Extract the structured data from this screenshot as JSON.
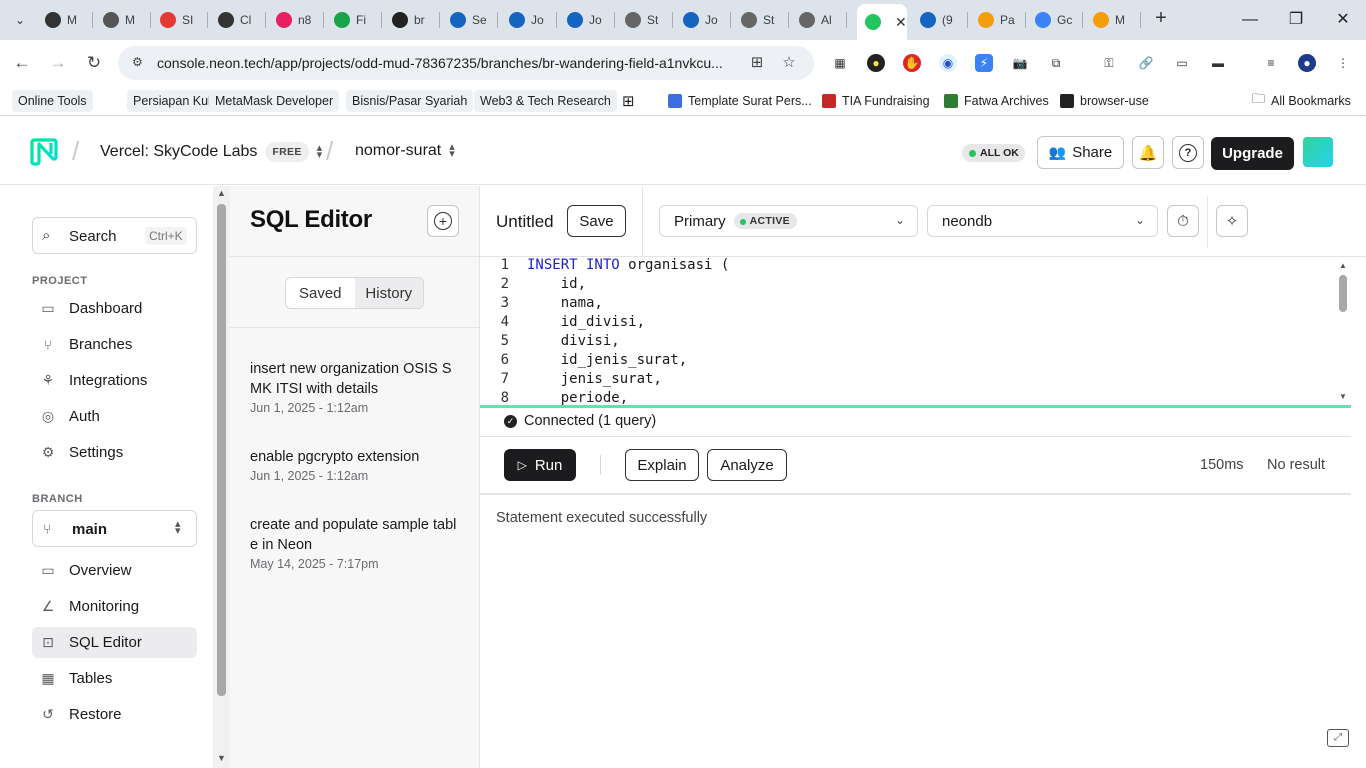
{
  "browser": {
    "tabs": [
      {
        "label": "M",
        "color": "#333"
      },
      {
        "label": "M",
        "color": "#555"
      },
      {
        "label": "SI",
        "color": "#e53935"
      },
      {
        "label": "Cl",
        "color": "#333"
      },
      {
        "label": "n8",
        "color": "#e91e63"
      },
      {
        "label": "Fi",
        "color": "#16a34a"
      },
      {
        "label": "br",
        "color": "#222"
      },
      {
        "label": "Se",
        "color": "#1565c0"
      },
      {
        "label": "Jo",
        "color": "#1565c0"
      },
      {
        "label": "Jo",
        "color": "#1565c0"
      },
      {
        "label": "St",
        "color": "#666"
      },
      {
        "label": "Jo",
        "color": "#1565c0"
      },
      {
        "label": "St",
        "color": "#666"
      },
      {
        "label": "Al",
        "color": "#666"
      },
      {
        "label": "",
        "color": "#22c55e",
        "active": true
      },
      {
        "label": "(9",
        "color": "#1565c0"
      },
      {
        "label": "Pa",
        "color": "#f59e0b"
      },
      {
        "label": "Gc",
        "color": "#3b82f6"
      },
      {
        "label": "M",
        "color": "#f59e0b"
      }
    ],
    "url": "console.neon.tech/app/projects/odd-mud-78367235/branches/br-wandering-field-a1nvkcu...",
    "bookmarks": [
      {
        "label": "Online Tools",
        "chip": true
      },
      {
        "label": "Persiapan Kuliah",
        "chip": true
      },
      {
        "label": "MetaMask Developer",
        "chip": true
      },
      {
        "label": "Bisnis/Pasar Syariah",
        "chip": true
      },
      {
        "label": "Web3 & Tech Research",
        "chip": true
      },
      {
        "label": "Template Surat Pers...",
        "icon_color": "#3b6fe0"
      },
      {
        "label": "TIA Fundraising",
        "icon_color": "#c62828"
      },
      {
        "label": "Fatwa Archives",
        "icon_color": "#2e7d32"
      },
      {
        "label": "browser-use",
        "icon_color": "#222"
      }
    ],
    "all_bookmarks": "All Bookmarks"
  },
  "header": {
    "org": "Vercel: SkyCode Labs",
    "plan": "FREE",
    "project": "nomor-surat",
    "status": "ALL OK",
    "share": "Share",
    "upgrade": "Upgrade"
  },
  "sidebar": {
    "search_label": "Search",
    "search_shortcut": "Ctrl+K",
    "project_label": "PROJECT",
    "project_items": [
      {
        "label": "Dashboard",
        "icon": "dashboard-icon"
      },
      {
        "label": "Branches",
        "icon": "branches-icon"
      },
      {
        "label": "Integrations",
        "icon": "integrations-icon"
      },
      {
        "label": "Auth",
        "icon": "auth-icon"
      },
      {
        "label": "Settings",
        "icon": "gear-icon"
      }
    ],
    "branch_label": "BRANCH",
    "branch_name": "main",
    "branch_items": [
      {
        "label": "Overview",
        "icon": "overview-icon"
      },
      {
        "label": "Monitoring",
        "icon": "monitoring-icon"
      },
      {
        "label": "SQL Editor",
        "icon": "sql-editor-icon",
        "active": true
      },
      {
        "label": "Tables",
        "icon": "tables-icon"
      },
      {
        "label": "Restore",
        "icon": "restore-icon"
      }
    ]
  },
  "history": {
    "title": "SQL Editor",
    "tabs": [
      "Saved",
      "History"
    ],
    "active_tab": "History",
    "items": [
      {
        "title": "insert new organization OSIS SMK ITSI with details",
        "date": "Jun 1, 2025 - 1:12am"
      },
      {
        "title": "enable pgcrypto extension",
        "date": "Jun 1, 2025 - 1:12am"
      },
      {
        "title": "create and populate sample table in Neon",
        "date": "May 14, 2025 - 7:17pm"
      }
    ]
  },
  "editor": {
    "query_name": "Untitled",
    "save_label": "Save",
    "compute": "Primary",
    "compute_status": "ACTIVE",
    "database": "neondb",
    "code_lines": [
      {
        "n": "1",
        "kw": "INSERT INTO",
        "rest": " organisasi ("
      },
      {
        "n": "2",
        "kw": "",
        "rest": "    id,"
      },
      {
        "n": "3",
        "kw": "",
        "rest": "    nama,"
      },
      {
        "n": "4",
        "kw": "",
        "rest": "    id_divisi,"
      },
      {
        "n": "5",
        "kw": "",
        "rest": "    divisi,"
      },
      {
        "n": "6",
        "kw": "",
        "rest": "    id_jenis_surat,"
      },
      {
        "n": "7",
        "kw": "",
        "rest": "    jenis_surat,"
      },
      {
        "n": "8",
        "kw": "",
        "rest": "    periode,"
      }
    ],
    "connection_status": "Connected (1 query)",
    "run_label": "Run",
    "explain_label": "Explain",
    "analyze_label": "Analyze",
    "duration": "150ms",
    "result_summary": "No result",
    "result_message": "Statement executed successfully"
  }
}
